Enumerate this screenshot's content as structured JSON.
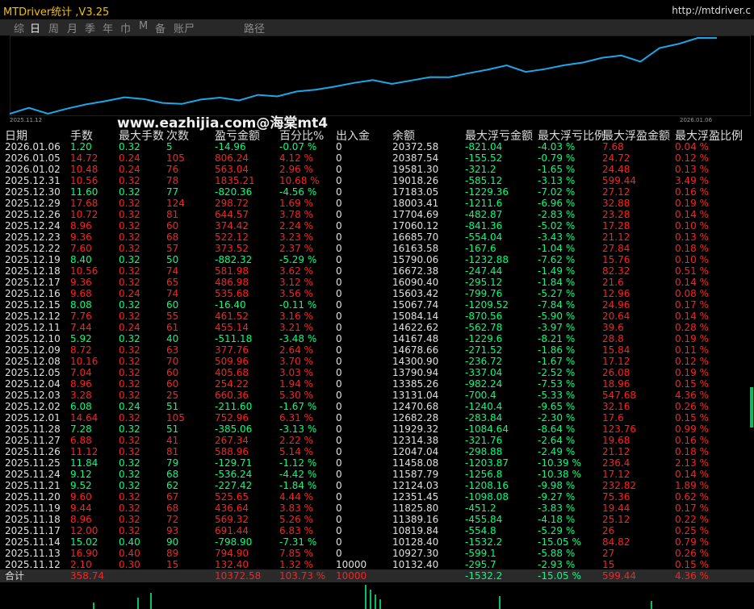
{
  "title": "MTDriver统计 ,V3.25",
  "url": "http://mtdriver.c",
  "tabs": [
    "综",
    "日",
    "周",
    "月",
    "季",
    "年",
    "巾",
    "M",
    "备",
    "账尸",
    "路径"
  ],
  "active_tab": "日",
  "watermark": "www.eazhijia.com@海棠mt4",
  "chart_axis": {
    "start": "2025.11.12",
    "end": "2026.01.06"
  },
  "curve": [
    10132.4,
    10927.3,
    10128.4,
    10819.84,
    11389.16,
    11825.8,
    12351.45,
    12124.03,
    11587.79,
    11458.08,
    12047.04,
    12314.38,
    11929.32,
    12682.28,
    12470.68,
    13131.04,
    13385.26,
    13790.94,
    14300.9,
    14678.66,
    14167.48,
    14622.62,
    15084.14,
    15067.74,
    15603.42,
    16090.4,
    16672.38,
    15790.06,
    16163.58,
    16685.7,
    17060.12,
    17704.69,
    18003.41,
    17183.05,
    19018.26,
    19581.3,
    20387.54,
    20372.58
  ],
  "headers": [
    "日期",
    "手数",
    "最大手数",
    "次数",
    "盈亏金额",
    "百分比%",
    "出入金",
    "余额",
    "最大浮亏金额",
    "最大浮亏比例",
    "最大浮盈金额",
    "最大浮盈比例"
  ],
  "rows": [
    [
      "2026.01.06",
      "1.20",
      "0.32",
      "5",
      "-14.96",
      "-0.07 %",
      "0",
      "20372.58",
      "-821.04",
      "-4.03 %",
      "7.68",
      "0.04 %"
    ],
    [
      "2026.01.05",
      "14.72",
      "0.24",
      "105",
      "806.24",
      "4.12 %",
      "0",
      "20387.54",
      "-155.52",
      "-0.79 %",
      "24.72",
      "0.12 %"
    ],
    [
      "2026.01.02",
      "10.48",
      "0.24",
      "76",
      "563.04",
      "2.96 %",
      "0",
      "19581.30",
      "-321.2",
      "-1.65 %",
      "24.48",
      "0.13 %"
    ],
    [
      "2025.12.31",
      "10.56",
      "0.32",
      "78",
      "1835.21",
      "10.68 %",
      "0",
      "19018.26",
      "-585.12",
      "-3.13 %",
      "599.44",
      "3.49 %"
    ],
    [
      "2025.12.30",
      "11.60",
      "0.32",
      "77",
      "-820.36",
      "-4.56 %",
      "0",
      "17183.05",
      "-1229.36",
      "-7.02 %",
      "27.12",
      "0.16 %"
    ],
    [
      "2025.12.29",
      "17.68",
      "0.32",
      "124",
      "298.72",
      "1.69 %",
      "0",
      "18003.41",
      "-1211.6",
      "-6.96 %",
      "32.88",
      "0.19 %"
    ],
    [
      "2025.12.26",
      "10.72",
      "0.32",
      "81",
      "644.57",
      "3.78 %",
      "0",
      "17704.69",
      "-482.87",
      "-2.83 %",
      "23.28",
      "0.14 %"
    ],
    [
      "2025.12.24",
      "8.96",
      "0.32",
      "60",
      "374.42",
      "2.24 %",
      "0",
      "17060.12",
      "-841.36",
      "-5.02 %",
      "17.28",
      "0.10 %"
    ],
    [
      "2025.12.23",
      "9.36",
      "0.32",
      "68",
      "522.12",
      "3.23 %",
      "0",
      "16685.70",
      "-554.04",
      "-3.43 %",
      "21.12",
      "0.13 %"
    ],
    [
      "2025.12.22",
      "7.60",
      "0.32",
      "57",
      "373.52",
      "2.37 %",
      "0",
      "16163.58",
      "-167.6",
      "-1.04 %",
      "27.84",
      "0.18 %"
    ],
    [
      "2025.12.19",
      "8.40",
      "0.32",
      "50",
      "-882.32",
      "-5.29 %",
      "0",
      "15790.06",
      "-1232.88",
      "-7.62 %",
      "15.76",
      "0.10 %"
    ],
    [
      "2025.12.18",
      "10.56",
      "0.32",
      "74",
      "581.98",
      "3.62 %",
      "0",
      "16672.38",
      "-247.44",
      "-1.49 %",
      "82.32",
      "0.51 %"
    ],
    [
      "2025.12.17",
      "9.36",
      "0.32",
      "65",
      "486.98",
      "3.12 %",
      "0",
      "16090.40",
      "-295.12",
      "-1.84 %",
      "21.6",
      "0.14 %"
    ],
    [
      "2025.12.16",
      "9.68",
      "0.24",
      "74",
      "535.68",
      "3.56 %",
      "0",
      "15603.42",
      "-799.76",
      "-5.27 %",
      "12.96",
      "0.08 %"
    ],
    [
      "2025.12.15",
      "8.08",
      "0.32",
      "60",
      "-16.40",
      "-0.11 %",
      "0",
      "15067.74",
      "-1209.52",
      "-7.84 %",
      "24.96",
      "0.17 %"
    ],
    [
      "2025.12.12",
      "7.76",
      "0.32",
      "55",
      "461.52",
      "3.16 %",
      "0",
      "15084.14",
      "-870.56",
      "-5.90 %",
      "20.64",
      "0.14 %"
    ],
    [
      "2025.12.11",
      "7.44",
      "0.24",
      "61",
      "455.14",
      "3.21 %",
      "0",
      "14622.62",
      "-562.78",
      "-3.97 %",
      "39.6",
      "0.28 %"
    ],
    [
      "2025.12.10",
      "5.92",
      "0.32",
      "40",
      "-511.18",
      "-3.48 %",
      "0",
      "14167.48",
      "-1229.6",
      "-8.21 %",
      "28.8",
      "0.19 %"
    ],
    [
      "2025.12.09",
      "8.72",
      "0.32",
      "63",
      "377.76",
      "2.64 %",
      "0",
      "14678.66",
      "-271.52",
      "-1.86 %",
      "15.84",
      "0.11 %"
    ],
    [
      "2025.12.08",
      "10.16",
      "0.32",
      "70",
      "509.96",
      "3.70 %",
      "0",
      "14300.90",
      "-236.72",
      "-1.67 %",
      "17.12",
      "0.12 %"
    ],
    [
      "2025.12.05",
      "7.04",
      "0.32",
      "60",
      "405.68",
      "3.03 %",
      "0",
      "13790.94",
      "-337.04",
      "-2.52 %",
      "26.08",
      "0.19 %"
    ],
    [
      "2025.12.04",
      "8.96",
      "0.32",
      "60",
      "254.22",
      "1.94 %",
      "0",
      "13385.26",
      "-982.24",
      "-7.53 %",
      "18.96",
      "0.15 %"
    ],
    [
      "2025.12.03",
      "3.28",
      "0.32",
      "25",
      "660.36",
      "5.30 %",
      "0",
      "13131.04",
      "-700.4",
      "-5.33 %",
      "547.68",
      "4.36 %"
    ],
    [
      "2025.12.02",
      "6.08",
      "0.24",
      "51",
      "-211.60",
      "-1.67 %",
      "0",
      "12470.68",
      "-1240.4",
      "-9.65 %",
      "32.16",
      "0.26 %"
    ],
    [
      "2025.12.01",
      "14.64",
      "0.32",
      "105",
      "752.96",
      "6.31 %",
      "0",
      "12682.28",
      "-283.84",
      "-2.30 %",
      "17.6",
      "0.15 %"
    ],
    [
      "2025.11.28",
      "7.28",
      "0.32",
      "51",
      "-385.06",
      "-3.13 %",
      "0",
      "11929.32",
      "-1084.64",
      "-8.64 %",
      "123.76",
      "0.99 %"
    ],
    [
      "2025.11.27",
      "6.88",
      "0.32",
      "41",
      "267.34",
      "2.22 %",
      "0",
      "12314.38",
      "-321.76",
      "-2.64 %",
      "19.68",
      "0.16 %"
    ],
    [
      "2025.11.26",
      "11.12",
      "0.32",
      "81",
      "588.96",
      "5.14 %",
      "0",
      "12047.04",
      "-298.88",
      "-2.49 %",
      "21.12",
      "0.18 %"
    ],
    [
      "2025.11.25",
      "11.84",
      "0.32",
      "79",
      "-129.71",
      "-1.12 %",
      "0",
      "11458.08",
      "-1203.87",
      "-10.39 %",
      "236.4",
      "2.13 %"
    ],
    [
      "2025.11.24",
      "9.12",
      "0.32",
      "68",
      "-536.24",
      "-4.42 %",
      "0",
      "11587.79",
      "-1256.8",
      "-10.38 %",
      "17.12",
      "0.14 %"
    ],
    [
      "2025.11.21",
      "9.52",
      "0.32",
      "62",
      "-227.42",
      "-1.84 %",
      "0",
      "12124.03",
      "-1208.16",
      "-9.98 %",
      "232.82",
      "1.89 %"
    ],
    [
      "2025.11.20",
      "9.60",
      "0.32",
      "67",
      "525.65",
      "4.44 %",
      "0",
      "12351.45",
      "-1098.08",
      "-9.27 %",
      "75.36",
      "0.62 %"
    ],
    [
      "2025.11.19",
      "9.44",
      "0.32",
      "68",
      "436.64",
      "3.83 %",
      "0",
      "11825.80",
      "-451.2",
      "-3.83 %",
      "19.44",
      "0.17 %"
    ],
    [
      "2025.11.18",
      "8.96",
      "0.32",
      "72",
      "569.32",
      "5.26 %",
      "0",
      "11389.16",
      "-455.84",
      "-4.18 %",
      "25.12",
      "0.22 %"
    ],
    [
      "2025.11.17",
      "12.00",
      "0.32",
      "93",
      "691.44",
      "6.83 %",
      "0",
      "10819.84",
      "-554.8",
      "-5.29 %",
      "26",
      "0.25 %"
    ],
    [
      "2025.11.14",
      "15.02",
      "0.40",
      "90",
      "-798.90",
      "-7.31 %",
      "0",
      "10128.40",
      "-1532.2",
      "-15.05 %",
      "84.82",
      "0.79 %"
    ],
    [
      "2025.11.13",
      "16.90",
      "0.40",
      "89",
      "794.90",
      "7.85 %",
      "0",
      "10927.30",
      "-599.1",
      "-5.88 %",
      "27",
      "0.26 %"
    ],
    [
      "2025.11.12",
      "2.10",
      "0.30",
      "15",
      "132.40",
      "1.32 %",
      "10000",
      "10132.40",
      "-295.7",
      "-2.93 %",
      "15",
      "0.15 %"
    ]
  ],
  "total": {
    "label": "合计",
    "lots": "358.74",
    "profit": "10372.58",
    "pct": "103.73 %",
    "deposit": "10000",
    "max_dd": "-1532.2",
    "max_dd_pct": "-15.05 %",
    "max_fp": "599.44",
    "max_fp_pct": "4.36 %"
  },
  "colors": {
    "up": "#00ff80",
    "down": "#ff2020",
    "curve": "#1aa8e8",
    "title": "#f0c000"
  }
}
